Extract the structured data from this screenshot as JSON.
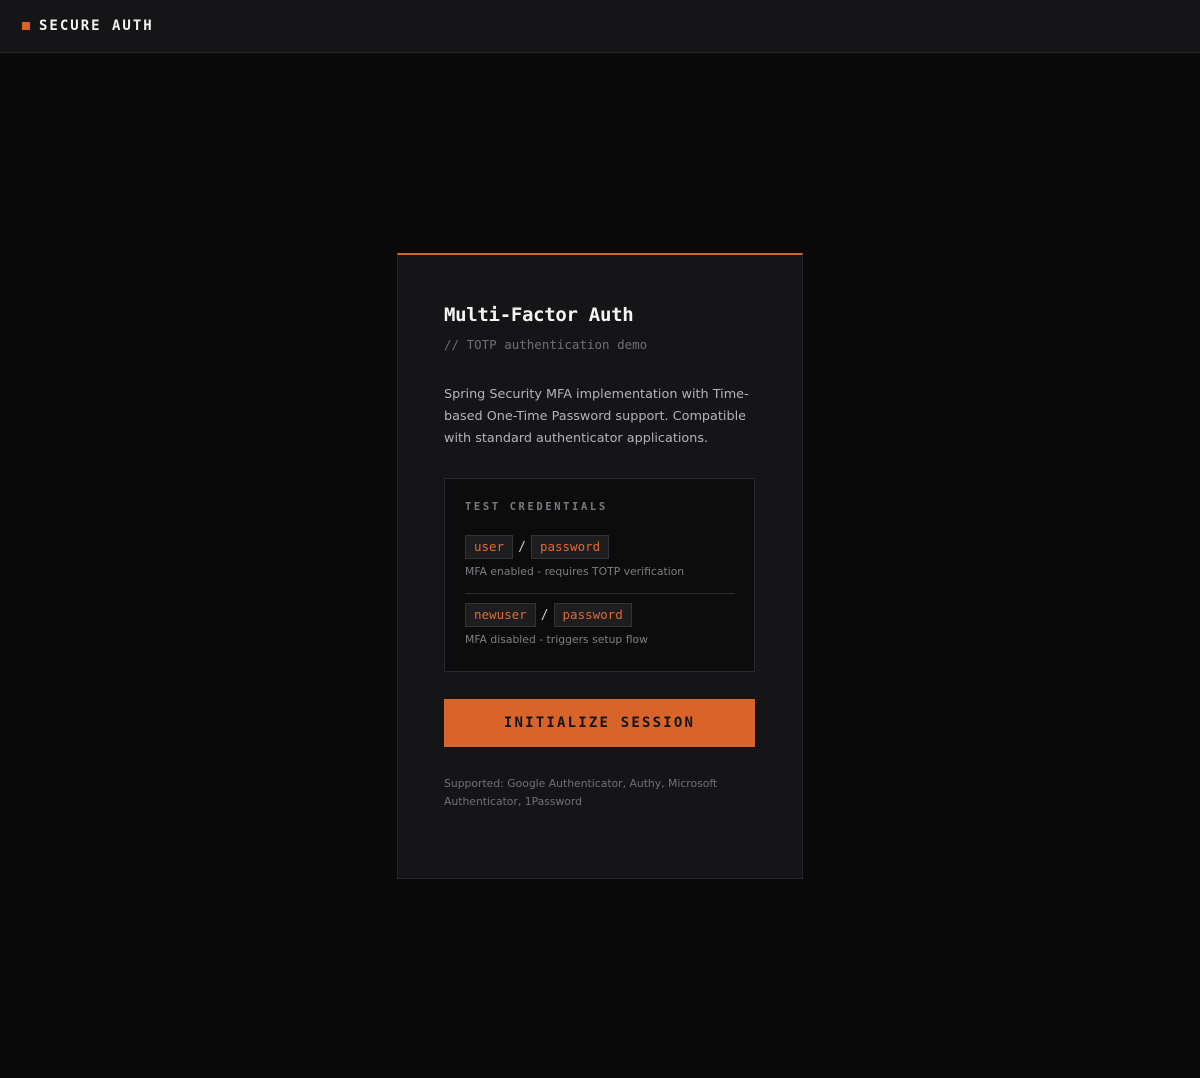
{
  "header": {
    "brand": "SECURE AUTH",
    "accent_color": "#d4642a"
  },
  "card": {
    "title": "Multi-Factor Auth",
    "subtitle": "// TOTP authentication demo",
    "description": "Spring Security MFA implementation with Time-based One-Time Password support. Compatible with standard authenticator applications.",
    "credentials": {
      "title": "TEST CREDENTIALS",
      "separator": "/",
      "items": [
        {
          "username": "user",
          "password": "password",
          "note": "MFA enabled - requires TOTP verification"
        },
        {
          "username": "newuser",
          "password": "password",
          "note": "MFA disabled - triggers setup flow"
        }
      ]
    },
    "cta_label": "INITIALIZE SESSION",
    "supported": "Supported: Google Authenticator, Authy, Microsoft Authenticator, 1Password"
  },
  "colors": {
    "background": "#0a0a0a",
    "card": "#151517",
    "accent": "#d9642a"
  }
}
